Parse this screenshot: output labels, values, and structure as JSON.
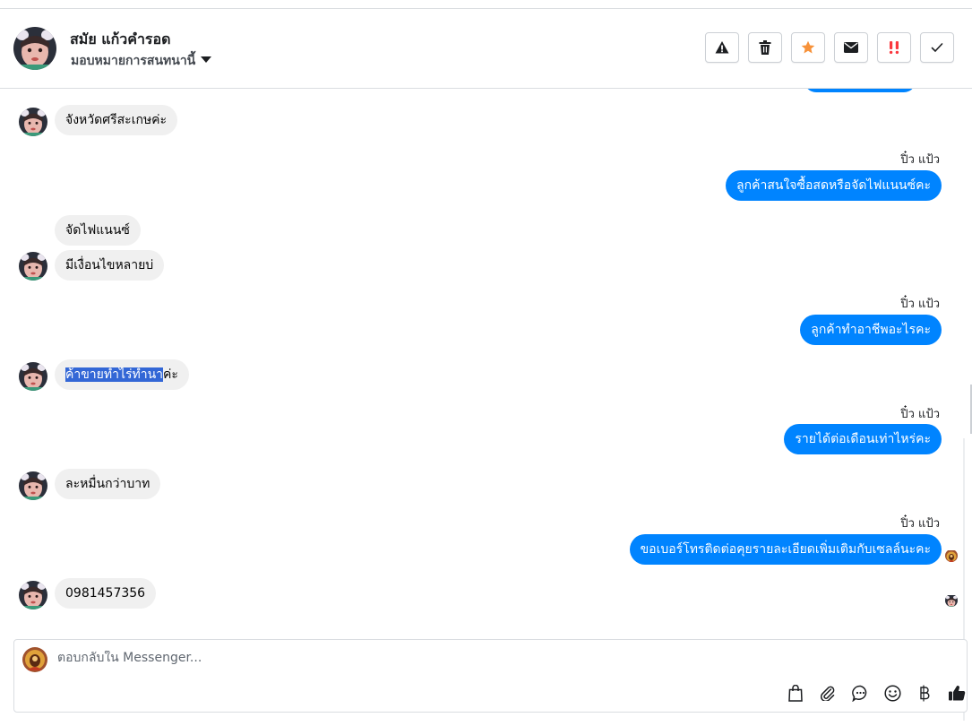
{
  "header": {
    "name": "สมัย แก้วคำรอด",
    "assign_label": "มอบหมายการสนทนานี้",
    "actions": [
      {
        "icon": "warning-icon"
      },
      {
        "icon": "trash-icon"
      },
      {
        "icon": "star-icon",
        "color": "#f7923a"
      },
      {
        "icon": "envelope-icon"
      },
      {
        "icon": "priority-icon",
        "color": "#fa383e"
      },
      {
        "icon": "check-icon"
      }
    ]
  },
  "thread": {
    "sender_name": "ปิ๋ว แป้ว",
    "messages": [
      {
        "from": "customer",
        "text": "จังหวัดศรีสะเกษค่ะ"
      },
      {
        "from": "page",
        "text": "ลูกค้าสนใจซื้อสดหรือจัดไฟแนนซ์คะ"
      },
      {
        "from": "customer",
        "text": "จัดไฟแนนซ์"
      },
      {
        "from": "customer",
        "text": "มีเงื่อนไขหลายบ่"
      },
      {
        "from": "page",
        "text": "ลูกค้าทำอาชีพอะไรคะ"
      },
      {
        "from": "customer",
        "text_selected": "ค้าขายทำไร่ทำนา",
        "text_rest": "ค่ะ"
      },
      {
        "from": "page",
        "text": "รายได้ต่อเดือนเท่าไหร่คะ"
      },
      {
        "from": "customer",
        "text": "ละหมื่นกว่าบาท"
      },
      {
        "from": "page",
        "text": "ขอเบอร์โทรติดต่อคุยรายละเอียดเพิ่มเติมกับเซลล์นะคะ"
      },
      {
        "from": "customer",
        "text": "0981457356"
      }
    ]
  },
  "composer": {
    "placeholder": "ตอบกลับใน Messenger...",
    "tools": [
      "shopping-bag-icon",
      "paperclip-icon",
      "saved-reply-icon",
      "emoji-icon",
      "baht-icon",
      "thumbs-up-icon"
    ]
  },
  "colors": {
    "outgoing_bubble": "#0084ff",
    "incoming_bubble": "#f0f0f0",
    "selection": "#3367d6"
  }
}
